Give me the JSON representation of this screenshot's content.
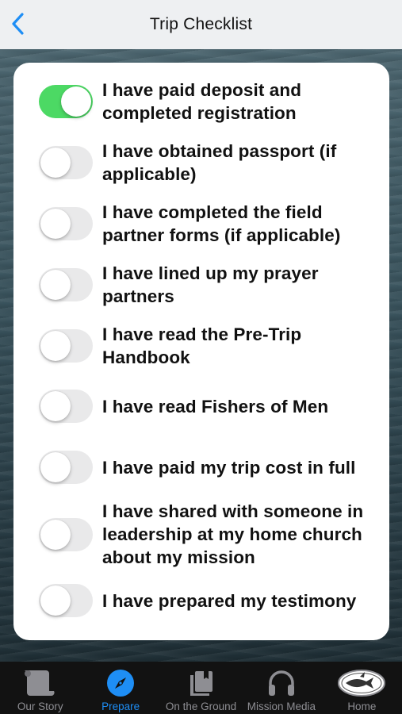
{
  "header": {
    "title": "Trip Checklist",
    "back_icon": "chevron-left-icon",
    "accent": "#1e8ef5"
  },
  "checklist": [
    {
      "lines": [
        "I have paid deposit and",
        "completed registration"
      ],
      "checked": true
    },
    {
      "lines": [
        "I have obtained passport (if",
        "applicable)"
      ],
      "checked": false
    },
    {
      "lines": [
        "I have completed the field",
        "partner forms (if applicable)"
      ],
      "checked": false
    },
    {
      "lines": [
        "I have lined up my prayer",
        "partners"
      ],
      "checked": false
    },
    {
      "lines": [
        "I have read the Pre-Trip",
        "Handbook"
      ],
      "checked": false
    },
    {
      "lines": [
        "I have read Fishers of Men"
      ],
      "checked": false
    },
    {
      "lines": [
        "I have paid my trip cost in full"
      ],
      "checked": false
    },
    {
      "lines": [
        "I have shared with someone in",
        "leadership at my home church",
        "about my mission"
      ],
      "checked": false
    },
    {
      "lines": [
        "I have prepared my testimony"
      ],
      "checked": false
    }
  ],
  "colors": {
    "toggle_on": "#4cd964",
    "toggle_off": "#e9e9ea"
  },
  "tabs": [
    {
      "label": "Our Story",
      "icon": "scroll-icon",
      "active": false
    },
    {
      "label": "Prepare",
      "icon": "compass-icon",
      "active": true
    },
    {
      "label": "On the Ground",
      "icon": "photos-icon",
      "active": false
    },
    {
      "label": "Mission Media",
      "icon": "headphones-icon",
      "active": false
    },
    {
      "label": "Home",
      "icon": "fish-logo-icon",
      "active": false
    }
  ]
}
